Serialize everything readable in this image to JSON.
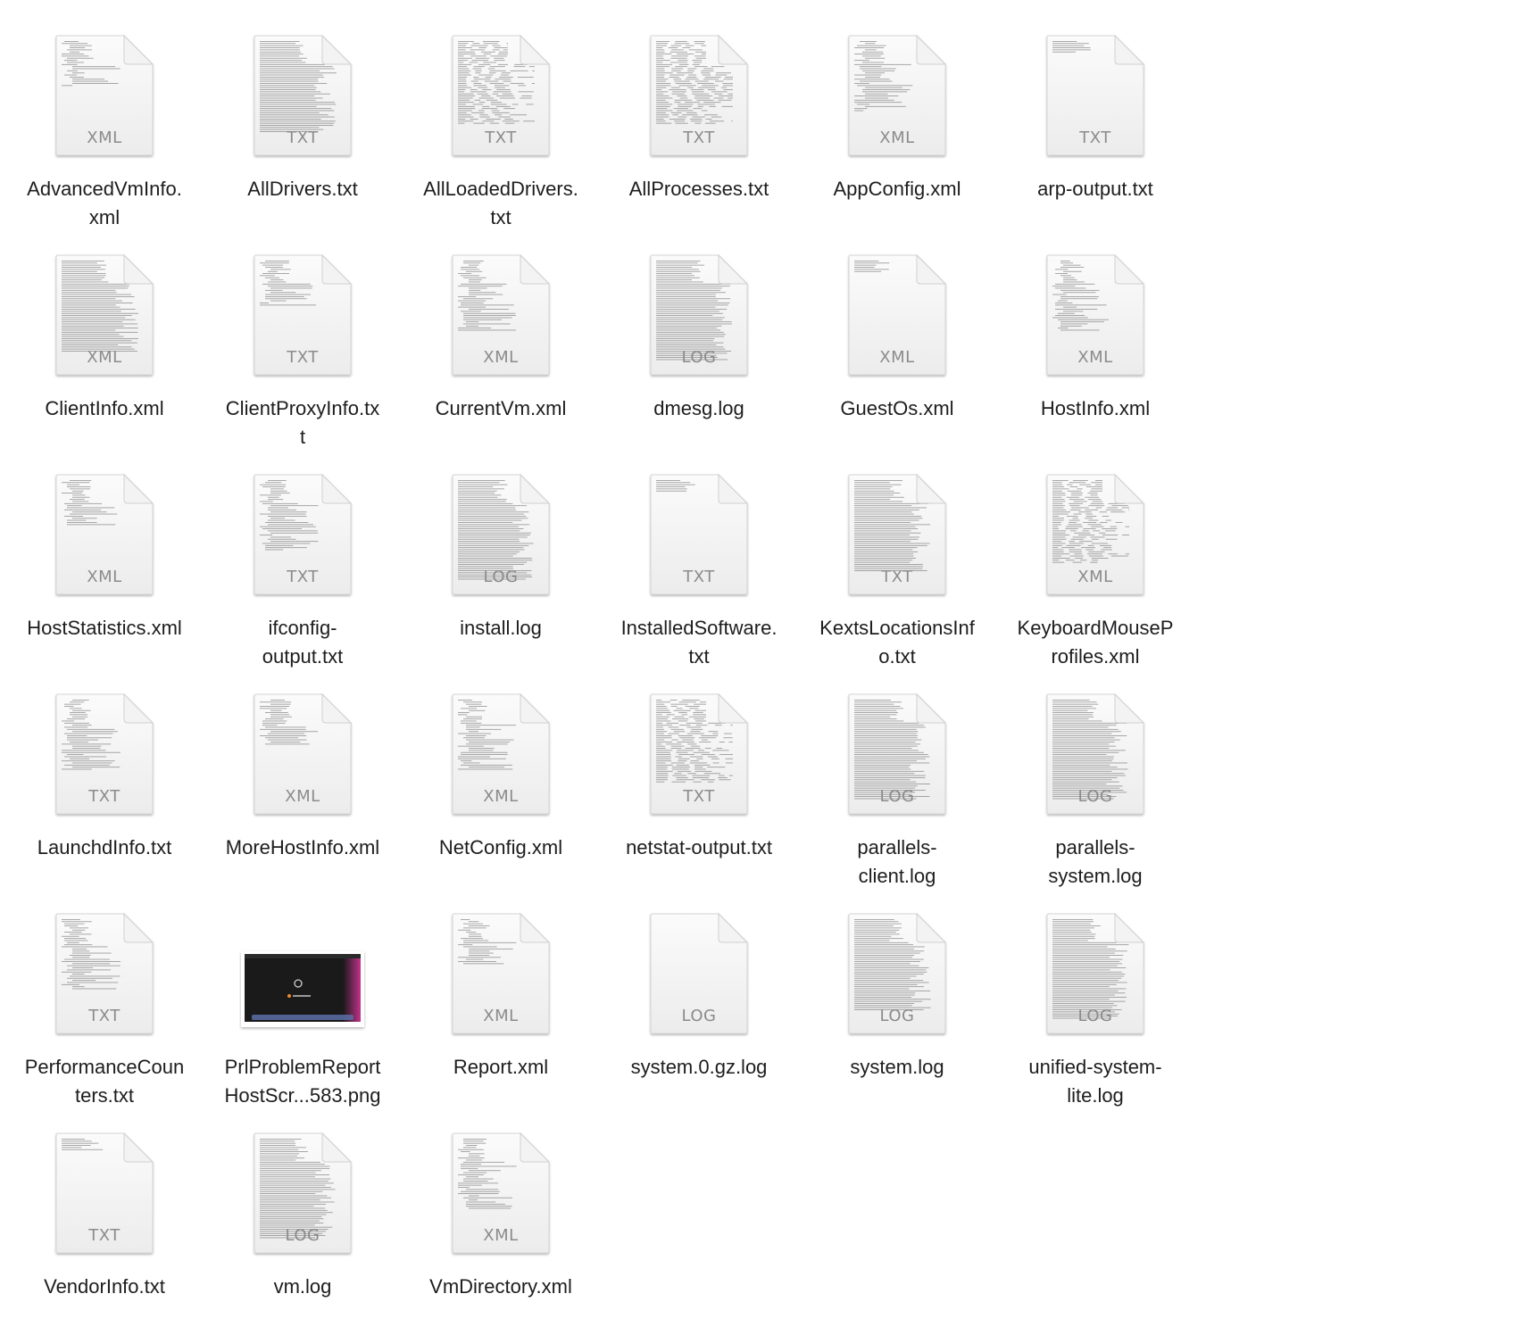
{
  "finder": {
    "view": "icons",
    "files": [
      {
        "name": "AdvancedVmInfo.\nxml",
        "kind": "XML",
        "density": "sparse"
      },
      {
        "name": "AllDrivers.txt",
        "kind": "TXT",
        "density": "dense"
      },
      {
        "name": "AllLoadedDrivers.\ntxt",
        "kind": "TXT",
        "density": "columns"
      },
      {
        "name": "AllProcesses.txt",
        "kind": "TXT",
        "density": "columns"
      },
      {
        "name": "AppConfig.xml",
        "kind": "XML",
        "density": "medium"
      },
      {
        "name": "arp-output.txt",
        "kind": "TXT",
        "density": "few"
      },
      {
        "name": "ClientInfo.xml",
        "kind": "XML",
        "density": "dense"
      },
      {
        "name": "ClientProxyInfo.tx\nt",
        "kind": "TXT",
        "density": "sparse"
      },
      {
        "name": "CurrentVm.xml",
        "kind": "XML",
        "density": "medium"
      },
      {
        "name": "dmesg.log",
        "kind": "LOG",
        "density": "full"
      },
      {
        "name": "GuestOs.xml",
        "kind": "XML",
        "density": "few"
      },
      {
        "name": "HostInfo.xml",
        "kind": "XML",
        "density": "medium"
      },
      {
        "name": "HostStatistics.xml",
        "kind": "XML",
        "density": "sparse"
      },
      {
        "name": "ifconfig-\noutput.txt",
        "kind": "TXT",
        "density": "medium"
      },
      {
        "name": "install.log",
        "kind": "LOG",
        "density": "full"
      },
      {
        "name": "InstalledSoftware.\ntxt",
        "kind": "TXT",
        "density": "few"
      },
      {
        "name": "KextsLocationsInf\no.txt",
        "kind": "TXT",
        "density": "dense"
      },
      {
        "name": "KeyboardMouseP\nrofiles.xml",
        "kind": "XML",
        "density": "columns"
      },
      {
        "name": "LaunchdInfo.txt",
        "kind": "TXT",
        "density": "medium"
      },
      {
        "name": "MoreHostInfo.xml",
        "kind": "XML",
        "density": "sparse"
      },
      {
        "name": "NetConfig.xml",
        "kind": "XML",
        "density": "medium"
      },
      {
        "name": "netstat-output.txt",
        "kind": "TXT",
        "density": "columns"
      },
      {
        "name": "parallels-\nclient.log",
        "kind": "LOG",
        "density": "full"
      },
      {
        "name": "parallels-\nsystem.log",
        "kind": "LOG",
        "density": "full"
      },
      {
        "name": "PerformanceCoun\nters.txt",
        "kind": "TXT",
        "density": "medium"
      },
      {
        "name": "PrlProblemReport\nHostScr...583.png",
        "kind": "PNG",
        "density": "image"
      },
      {
        "name": "Report.xml",
        "kind": "XML",
        "density": "sparse"
      },
      {
        "name": "system.0.gz.log",
        "kind": "LOG",
        "density": "none"
      },
      {
        "name": "system.log",
        "kind": "LOG",
        "density": "dense"
      },
      {
        "name": "unified-system-\nlite.log",
        "kind": "LOG",
        "density": "full"
      },
      {
        "name": "VendorInfo.txt",
        "kind": "TXT",
        "density": "few"
      },
      {
        "name": "vm.log",
        "kind": "LOG",
        "density": "full"
      },
      {
        "name": "VmDirectory.xml",
        "kind": "XML",
        "density": "medium"
      }
    ]
  }
}
